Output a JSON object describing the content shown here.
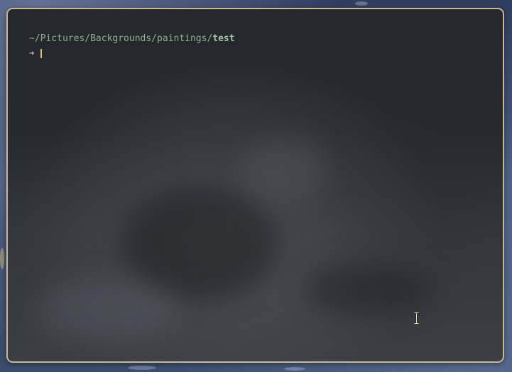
{
  "terminal": {
    "cwd_prefix": "~/Pictures/Backgrounds/paintings/",
    "cwd_leaf": "test",
    "prompt_symbol": "➜"
  },
  "colors": {
    "border": "#c9b98e",
    "path": "#8fb18a",
    "cursor": "#e2c27a"
  },
  "icons": {
    "mouse_pointer": "ibeam-cursor-icon"
  }
}
